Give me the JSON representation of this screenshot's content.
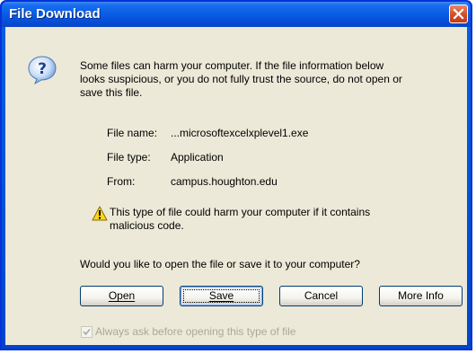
{
  "window": {
    "title": "File Download"
  },
  "message": {
    "line1": "Some files can harm your computer. If the file information below",
    "line2": "looks suspicious, or you do not fully trust the source, do not open or",
    "line3": "save this file."
  },
  "file": {
    "name_label": "File name:",
    "name_value": "...microsoftexcelxplevel1.exe",
    "type_label": "File type:",
    "type_value": "Application",
    "from_label": "From:",
    "from_value": "campus.houghton.edu"
  },
  "warning": {
    "line1": "This type of file could harm your computer if it contains",
    "line2": "malicious code."
  },
  "question": "Would you like to open the file or save it to your computer?",
  "buttons": {
    "open": "Open",
    "save": "Save",
    "cancel": "Cancel",
    "more_info": "More Info"
  },
  "checkbox": {
    "label": "Always ask before opening this type of file",
    "checked": true,
    "enabled": false
  },
  "icons": {
    "question": "question-icon",
    "warning": "warning-icon",
    "close": "close-icon"
  }
}
